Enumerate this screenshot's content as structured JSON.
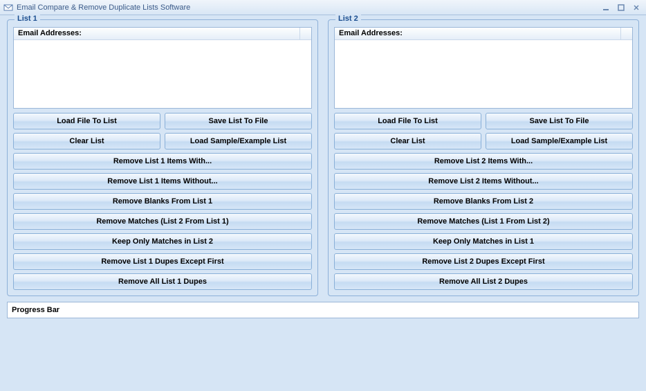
{
  "window": {
    "title": "Email Compare & Remove Duplicate Lists Software"
  },
  "list1": {
    "legend": "List 1",
    "column_header": "Email Addresses:",
    "buttons": {
      "load_file": "Load File To List",
      "save_file": "Save List To File",
      "clear": "Clear List",
      "load_sample": "Load Sample/Example List",
      "remove_with": "Remove List 1 Items With...",
      "remove_without": "Remove List 1 Items Without...",
      "remove_blanks": "Remove Blanks From List 1",
      "remove_matches": "Remove Matches (List 2 From List 1)",
      "keep_matches": "Keep Only Matches in List 2",
      "remove_dupes_except_first": "Remove List 1 Dupes Except First",
      "remove_all_dupes": "Remove All List 1 Dupes"
    }
  },
  "list2": {
    "legend": "List 2",
    "column_header": "Email Addresses:",
    "buttons": {
      "load_file": "Load File To List",
      "save_file": "Save List To File",
      "clear": "Clear List",
      "load_sample": "Load Sample/Example List",
      "remove_with": "Remove List 2 Items With...",
      "remove_without": "Remove List 2 Items Without...",
      "remove_blanks": "Remove Blanks From List 2",
      "remove_matches": "Remove Matches (List 1 From List 2)",
      "keep_matches": "Keep Only Matches in List 1",
      "remove_dupes_except_first": "Remove List 2 Dupes Except First",
      "remove_all_dupes": "Remove All List 2 Dupes"
    }
  },
  "progress": {
    "label": "Progress Bar"
  }
}
